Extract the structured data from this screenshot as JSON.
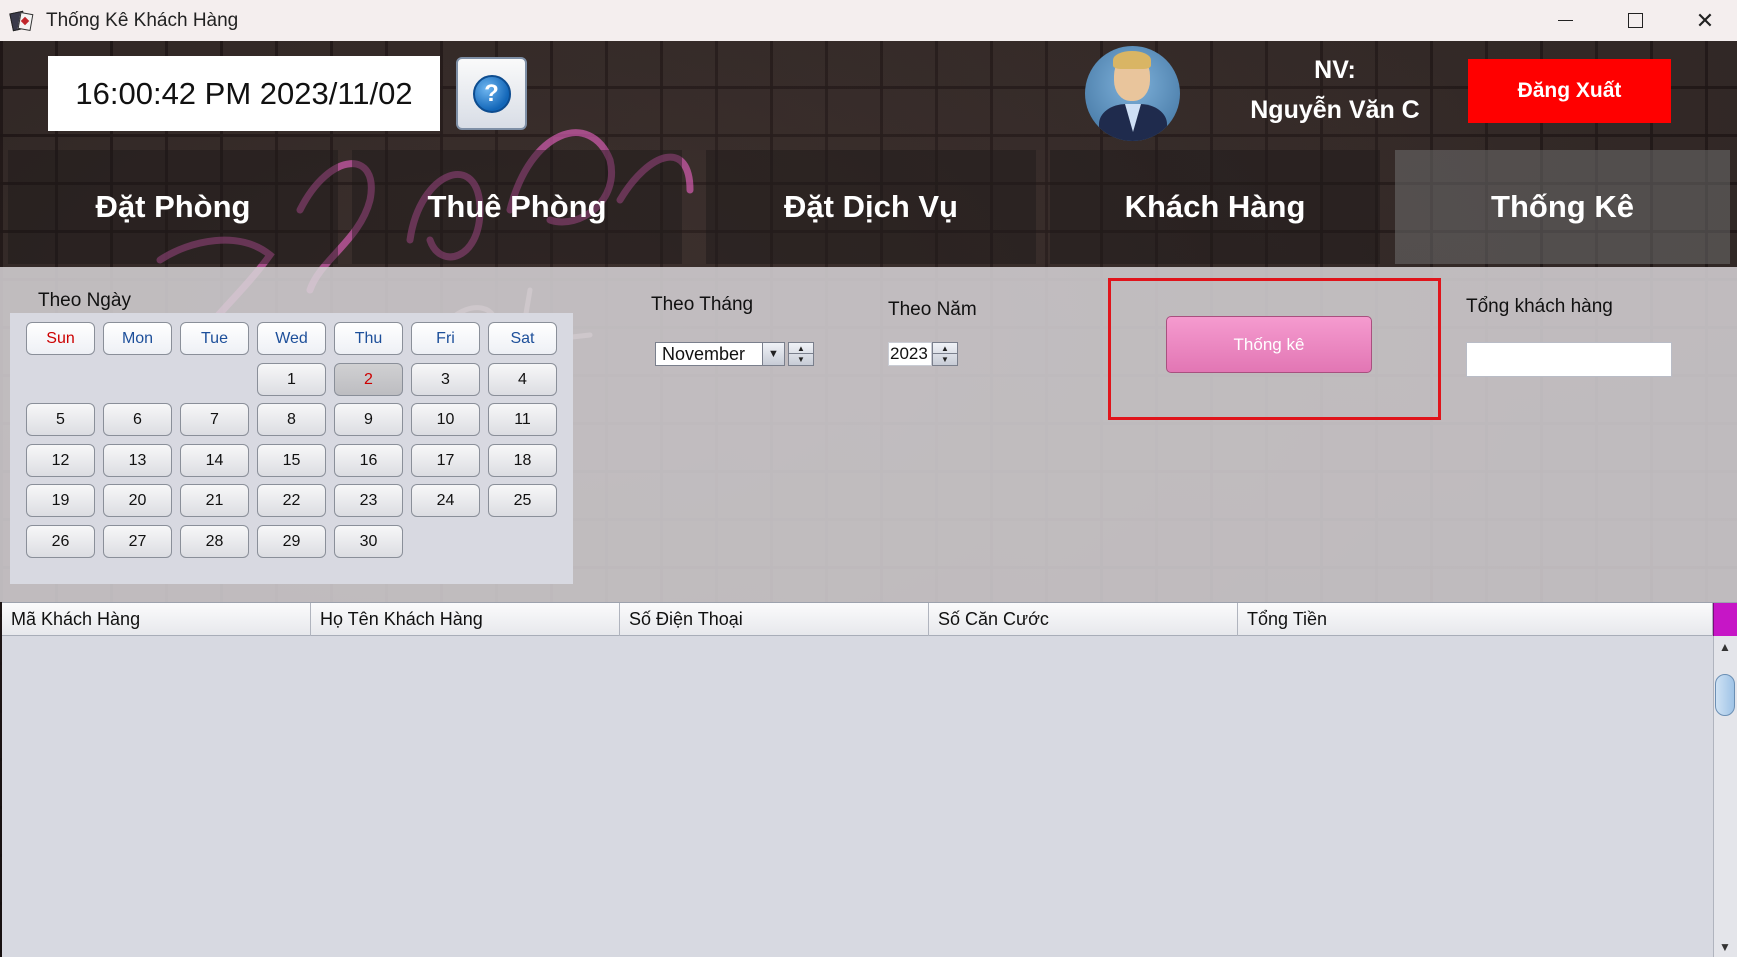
{
  "window": {
    "title": "Thống Kê Khách Hàng"
  },
  "header": {
    "clock": "16:00:42 PM  2023/11/02",
    "help_symbol": "?",
    "nv_label": "NV:",
    "employee_name": "Nguyễn Văn C",
    "logout_label": "Đăng Xuất"
  },
  "nav": {
    "tabs": [
      {
        "label": "Đặt Phòng"
      },
      {
        "label": "Thuê Phòng"
      },
      {
        "label": "Đặt Dịch Vụ"
      },
      {
        "label": "Khách Hàng"
      },
      {
        "label": "Thống Kê",
        "active": true
      }
    ]
  },
  "filters": {
    "day_label": "Theo Ngày",
    "month_label": "Theo Tháng",
    "year_label": "Theo Năm",
    "month_value": "November",
    "year_value": "2023",
    "stat_button": "Thống kê",
    "total_label": "Tổng khách hàng",
    "total_value": ""
  },
  "calendar": {
    "weekdays": [
      "Sun",
      "Mon",
      "Tue",
      "Wed",
      "Thu",
      "Fri",
      "Sat"
    ],
    "first_weekday_index": 3,
    "days_in_month": 30,
    "selected_day": 2
  },
  "table": {
    "columns": [
      "Mã Khách Hàng",
      "Họ Tên Khách Hàng",
      "Số Điện Thoại",
      "Số Căn Cước",
      "Tổng Tiền"
    ],
    "rows": []
  },
  "colors": {
    "logout_bg": "#ff0000",
    "stat_button_bg": "#ee8ac4",
    "highlight_border": "#e0141b",
    "neon_pink": "#ff5fd0"
  },
  "icons": [
    "help-icon",
    "avatar",
    "minimize-icon",
    "maximize-icon",
    "close-icon",
    "app-icon"
  ]
}
